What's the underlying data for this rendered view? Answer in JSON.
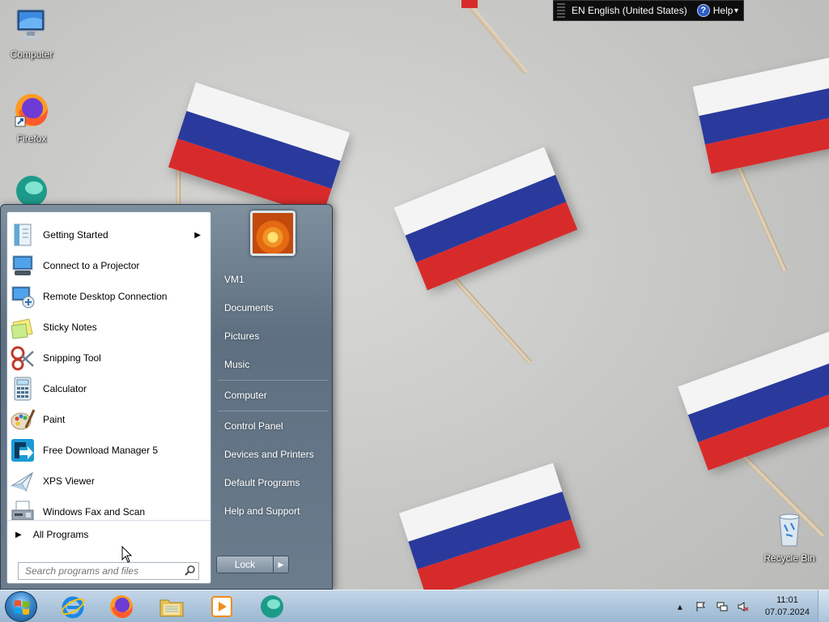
{
  "desktop": {
    "icons": [
      {
        "label": "Computer",
        "icon": "computer-icon"
      },
      {
        "label": "Firefox",
        "icon": "firefox-icon"
      },
      {
        "label": "Recycle Bin",
        "icon": "recycle-bin-icon"
      }
    ]
  },
  "language_bar": {
    "language": "EN English (United States)",
    "help": "Help"
  },
  "start_menu": {
    "programs": [
      {
        "label": "Getting Started",
        "icon": "getting-started-icon",
        "has_submenu": true
      },
      {
        "label": "Connect to a Projector",
        "icon": "projector-icon"
      },
      {
        "label": "Remote Desktop Connection",
        "icon": "remote-desktop-icon"
      },
      {
        "label": "Sticky Notes",
        "icon": "sticky-notes-icon"
      },
      {
        "label": "Snipping Tool",
        "icon": "snipping-tool-icon"
      },
      {
        "label": "Calculator",
        "icon": "calculator-icon"
      },
      {
        "label": "Paint",
        "icon": "paint-icon"
      },
      {
        "label": "Free Download Manager 5",
        "icon": "fdm-icon"
      },
      {
        "label": "XPS Viewer",
        "icon": "xps-viewer-icon"
      },
      {
        "label": "Windows Fax and Scan",
        "icon": "fax-scan-icon"
      }
    ],
    "all_programs": "All Programs",
    "search_placeholder": "Search programs and files",
    "right_items": [
      "VM1",
      "Documents",
      "Pictures",
      "Music",
      "Computer",
      "Control Panel",
      "Devices and Printers",
      "Default Programs",
      "Help and Support"
    ],
    "lock_label": "Lock"
  },
  "taskbar": {
    "pinned": [
      "internet-explorer-icon",
      "firefox-icon",
      "windows-explorer-icon",
      "media-player-icon",
      "app-icon"
    ],
    "clock_time": "11:01",
    "clock_date": "07.07.2024"
  },
  "colors": {
    "taskbar": "#aec6dc",
    "start_menu_frame": "#6b7d8d",
    "flag_white": "#f4f4f4",
    "flag_blue": "#2a3a9c",
    "flag_red": "#d72b2b"
  }
}
